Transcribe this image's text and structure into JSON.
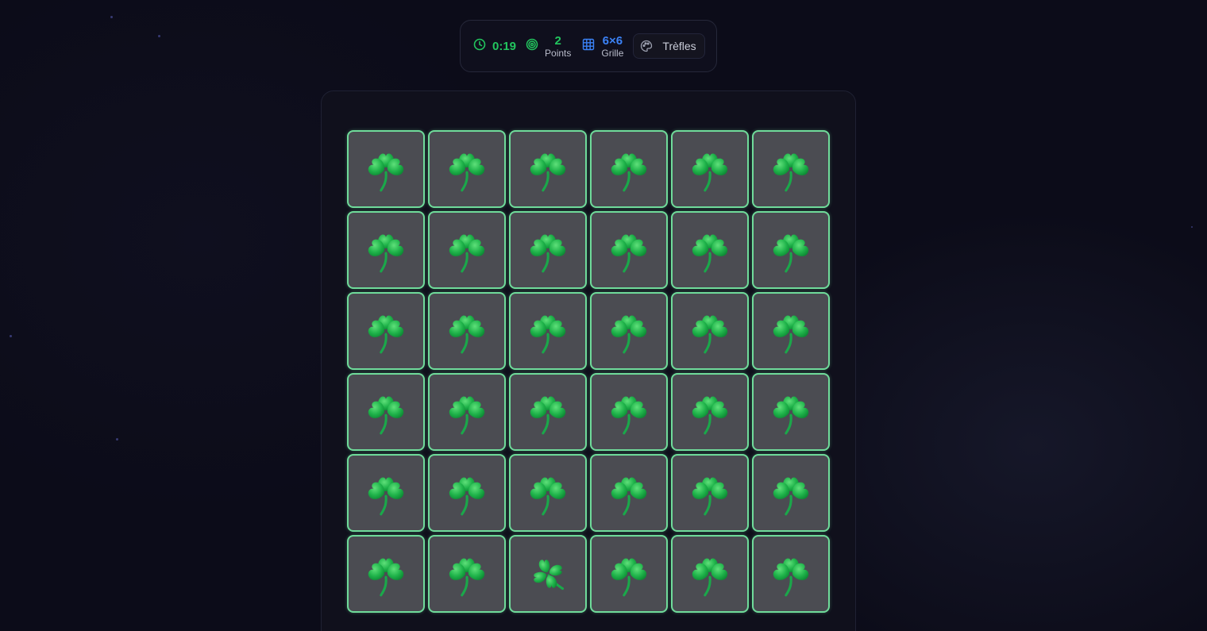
{
  "hud": {
    "timer": "0:19",
    "score_value": "2",
    "score_label": "Points",
    "grid_value": "6×6",
    "grid_label": "Grille",
    "theme_label": "Trèfles"
  },
  "colors": {
    "accent_green": "#22c55e",
    "accent_blue": "#3b82f6",
    "card_border": "#6fdb9a",
    "card_face": "#4b4c52"
  },
  "board": {
    "rows": 6,
    "cols": 6,
    "cards": [
      "shamrock",
      "shamrock",
      "shamrock",
      "shamrock",
      "shamrock",
      "shamrock",
      "shamrock",
      "shamrock",
      "shamrock",
      "shamrock",
      "shamrock",
      "shamrock",
      "shamrock",
      "shamrock",
      "shamrock",
      "shamrock",
      "shamrock",
      "shamrock",
      "shamrock",
      "shamrock",
      "shamrock",
      "shamrock",
      "shamrock",
      "shamrock",
      "shamrock",
      "shamrock",
      "shamrock",
      "shamrock",
      "shamrock",
      "shamrock",
      "shamrock",
      "shamrock",
      "four-leaf-clover",
      "shamrock",
      "shamrock",
      "shamrock"
    ]
  }
}
